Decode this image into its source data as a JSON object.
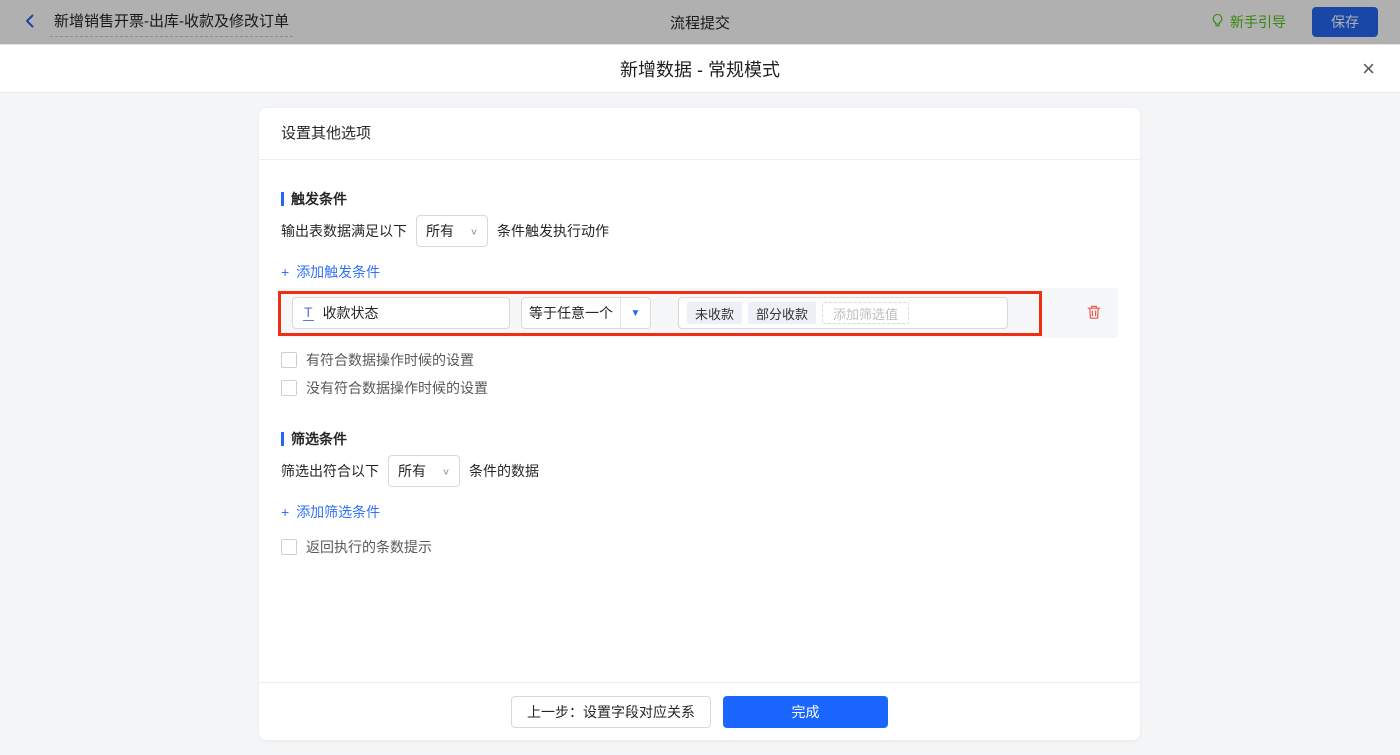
{
  "topbar": {
    "flow_title": "新增销售开票-出库-收款及修改订单",
    "center_title": "流程提交",
    "guide_label": "新手引导",
    "save_label": "保存"
  },
  "modal": {
    "title": "新增数据 - 常规模式",
    "close_icon": "×"
  },
  "panel": {
    "header_title": "设置其他选项",
    "trigger": {
      "section_title": "触发条件",
      "sentence_prefix": "输出表数据满足以下",
      "match_select_value": "所有",
      "sentence_suffix": "条件触发执行动作",
      "add_condition_label": "添加触发条件",
      "condition_row": {
        "field_type_icon": "T",
        "field_name": "收款状态",
        "operator": "等于任意一个",
        "value_tags": [
          "未收款",
          "部分收款"
        ],
        "add_value_placeholder": "添加筛选值"
      },
      "checkbox_has_match": "有符合数据操作时候的设置",
      "checkbox_no_match": "没有符合数据操作时候的设置"
    },
    "filter": {
      "section_title": "筛选条件",
      "sentence_prefix": "筛选出符合以下",
      "match_select_value": "所有",
      "sentence_suffix": "条件的数据",
      "add_condition_label": "添加筛选条件",
      "checkbox_row_count": "返回执行的条数提示"
    },
    "footer": {
      "prev_button": "上一步：设置字段对应关系",
      "done_button": "完成"
    }
  },
  "icons": {
    "plus": "+",
    "select_chevron": "∨",
    "dropdown_caret": "▼"
  },
  "colors": {
    "primary_blue": "#2468f2",
    "button_blue": "#1a66ff",
    "link_blue": "#3370ff",
    "guide_green": "#52c41a",
    "annotation_red": "#ee2f12",
    "danger_red": "#f25549",
    "page_bg": "#f4f5f6"
  }
}
